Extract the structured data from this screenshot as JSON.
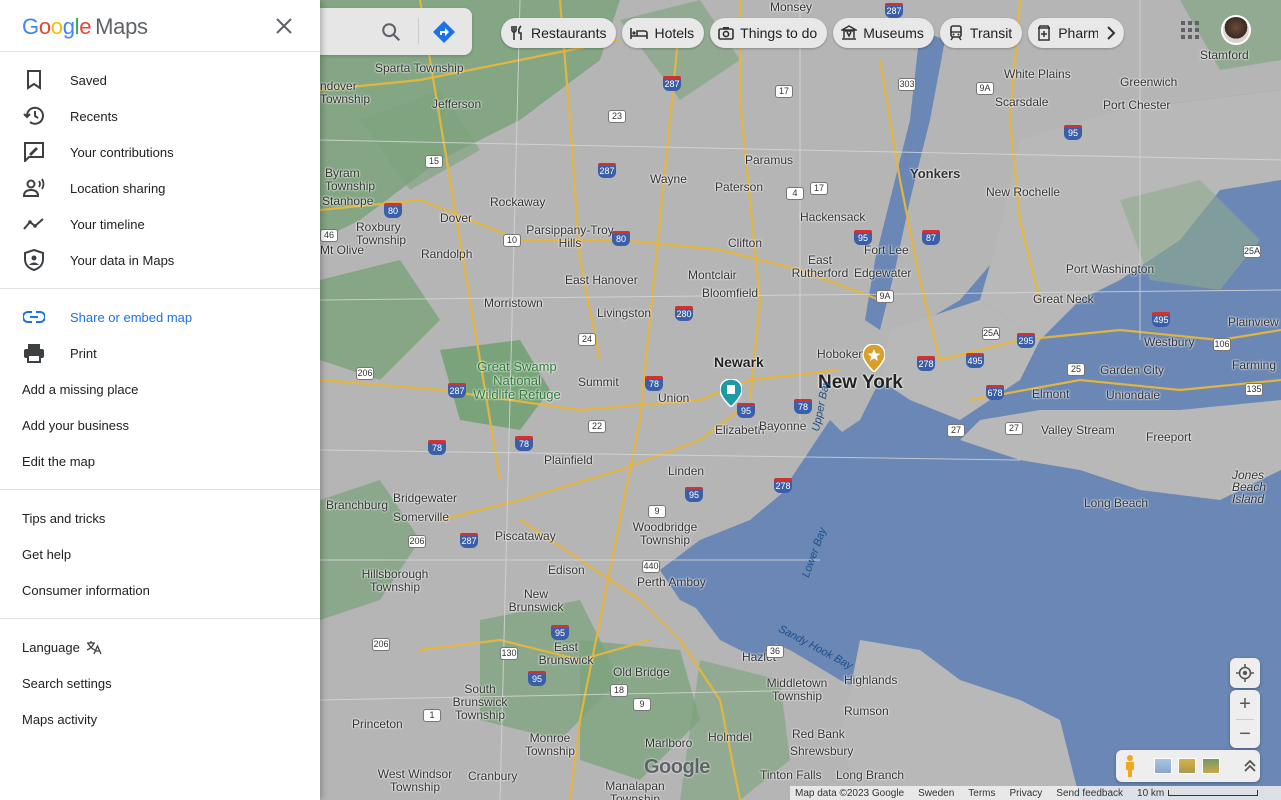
{
  "sidebar": {
    "logo": {
      "g": "G",
      "o1": "o",
      "o2": "o",
      "g2": "g",
      "l": "l",
      "e": "e",
      "maps": "Maps"
    },
    "sections": [
      [
        {
          "label": "Saved",
          "icon": "bookmark-icon"
        },
        {
          "label": "Recents",
          "icon": "history-icon"
        },
        {
          "label": "Your contributions",
          "icon": "contributions-icon"
        },
        {
          "label": "Location sharing",
          "icon": "location-sharing-icon"
        },
        {
          "label": "Your timeline",
          "icon": "timeline-icon"
        },
        {
          "label": "Your data in Maps",
          "icon": "shield-user-icon"
        }
      ],
      [
        {
          "label": "Share or embed map",
          "icon": "link-icon"
        },
        {
          "label": "Print",
          "icon": "print-icon"
        },
        {
          "label": "Add a missing place"
        },
        {
          "label": "Add your business"
        },
        {
          "label": "Edit the map"
        }
      ],
      [
        {
          "label": "Tips and tricks"
        },
        {
          "label": "Get help"
        },
        {
          "label": "Consumer information"
        }
      ],
      [
        {
          "label": "Language"
        },
        {
          "label": "Search settings"
        },
        {
          "label": "Maps activity"
        }
      ]
    ]
  },
  "chips": [
    {
      "label": "Restaurants",
      "icon": "restaurant-icon"
    },
    {
      "label": "Hotels",
      "icon": "hotel-icon"
    },
    {
      "label": "Things to do",
      "icon": "camera-icon"
    },
    {
      "label": "Museums",
      "icon": "museum-icon"
    },
    {
      "label": "Transit",
      "icon": "transit-icon"
    },
    {
      "label": "Pharmacies",
      "icon": "pharmacy-icon"
    }
  ],
  "map_labels": {
    "new_york": "New York",
    "newark": "Newark",
    "yonkers": "Yonkers",
    "paterson": "Paterson",
    "clifton": "Clifton",
    "hackensack": "Hackensack",
    "paramus": "Paramus",
    "wayne": "Wayne",
    "white_plains": "White Plains",
    "stamford": "Stamford",
    "greenwich": "Greenwich",
    "port_chester": "Port Chester",
    "scarsdale": "Scarsdale",
    "new_rochelle": "New Rochelle",
    "fort_lee": "Fort Lee",
    "edgewater": "Edgewater",
    "east_rutherford": "East Rutherford",
    "montclair": "Montclair",
    "bloomfield": "Bloomfield",
    "livingston": "Livingston",
    "east_hanover": "East Hanover",
    "morristown": "Morristown",
    "hoboken": "Hoboken",
    "union": "Union",
    "elizabeth": "Elizabeth",
    "bayonne": "Bayonne",
    "linden": "Linden",
    "plainfield": "Plainfield",
    "summit": "Summit",
    "woodbridge": "Woodbridge Township",
    "perth_amboy": "Perth Amboy",
    "edison": "Edison",
    "piscataway": "Piscataway",
    "new_brunswick": "New Brunswick",
    "east_brunswick": "East Brunswick",
    "bridgewater": "Bridgewater",
    "branchburg": "Branchburg",
    "somerville": "Somerville",
    "hillsborough": "Hillsborough Township",
    "princeton": "Princeton",
    "south_brunswick": "South Brunswick Township",
    "monroe": "Monroe Township",
    "old_bridge": "Old Bridge",
    "marlboro": "Marlboro",
    "holmdel": "Holmdel",
    "hazlet": "Hazlet",
    "middletown": "Middletown Township",
    "red_bank": "Red Bank",
    "shrewsbury": "Shrewsbury",
    "highlands": "Highlands",
    "rumson": "Rumson",
    "tinton_falls": "Tinton Falls",
    "long_branch": "Long Branch",
    "west_windsor": "West Windsor Township",
    "cranbury": "Cranbury",
    "manalapan": "Manalapan Township",
    "port_washington": "Port Washington",
    "great_neck": "Great Neck",
    "westbury": "Westbury",
    "garden_city": "Garden City",
    "uniondale": "Uniondale",
    "elmont": "Elmont",
    "valley_stream": "Valley Stream",
    "freeport": "Freeport",
    "long_beach": "Long Beach",
    "plainview": "Plainview",
    "farming": "Farming",
    "jones_beach": "Jones Beach Island",
    "great_swamp": "Great Swamp National Wildlife Refuge",
    "rockaway": "Rockaway",
    "dover": "Dover",
    "randolph": "Randolph",
    "jefferson": "Jefferson",
    "sparta": "Sparta Township",
    "parsippany": "Parsippany-Troy Hills",
    "roxbury": "Roxbury Township",
    "byram": "Byram Township",
    "stanhope": "Stanhope",
    "mt_olive": "Mt Olive",
    "ndover": "ndover Township",
    "upper_bay": "Upper Bay",
    "lower_bay": "Lower Bay",
    "sandy_hook": "Sandy Hook Bay",
    "monsey": "Monsey"
  },
  "footer": {
    "map_data": "Map data ©2023 Google",
    "country": "Sweden",
    "terms": "Terms",
    "privacy": "Privacy",
    "feedback": "Send feedback",
    "scale": "10 km"
  },
  "watermark": "Google",
  "colors": {
    "land": "#b9b9b9",
    "water": "#6a87b5",
    "park": "#7ba37b",
    "road": "#e7b73a",
    "accent": "#1a73e8"
  }
}
